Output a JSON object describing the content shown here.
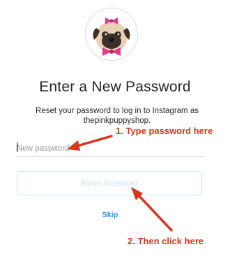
{
  "icons": {
    "profile_avatar": "pug-with-pink-bow-icon",
    "annotation_arrow": "red-arrow-icon"
  },
  "colors": {
    "accent": "#3897f0",
    "annotation": "#d8361f"
  },
  "header": {
    "title": "Enter a New Password"
  },
  "description": {
    "text": "Reset your password to log in to Instagram as thepinkpuppyshop."
  },
  "form": {
    "password_placeholder": "New password",
    "password_value": "",
    "reset_label": "Reset Password",
    "skip_label": "Skip"
  },
  "annotations": {
    "step1": "1. Type password here",
    "step2": "2. Then click here"
  }
}
